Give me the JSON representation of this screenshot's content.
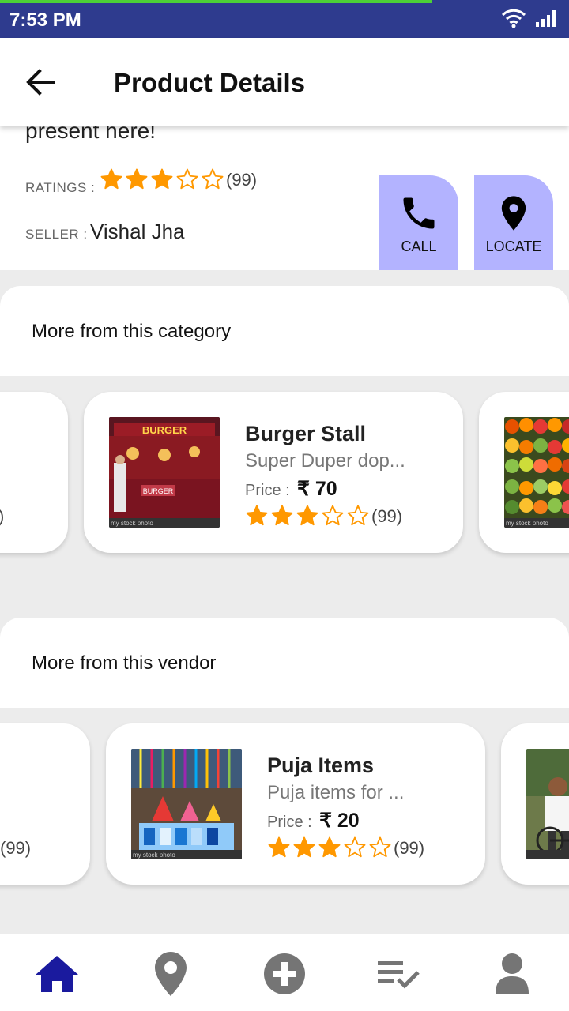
{
  "status": {
    "time": "7:53 PM",
    "progress": 0.76
  },
  "header": {
    "title": "Product Details"
  },
  "product": {
    "description_tail": "present here!",
    "ratings_label": "RATINGS :",
    "rating": 3,
    "rating_max": 5,
    "rating_count": "(99)",
    "seller_label": "SELLER :",
    "seller_name": "Vishal Jha"
  },
  "actions": {
    "call_label": "CALL",
    "locate_label": "LOCATE"
  },
  "category_section": {
    "title": "More from this category",
    "items": [
      {
        "title": "Burger Stall",
        "description": "Super Duper dop...",
        "price_label": "Price :",
        "price": "₹ 70",
        "rating": 3,
        "rating_count": "(99)"
      }
    ],
    "peek_left_count": ")"
  },
  "vendor_section": {
    "title": "More from this vendor",
    "items": [
      {
        "title": "Puja Items",
        "description": "Puja items for ...",
        "price_label": "Price :",
        "price": "₹ 20",
        "rating": 3,
        "rating_count": "(99)"
      }
    ],
    "peek_left_count": "(99)"
  },
  "image_watermark": "my stock photo",
  "burger_sign": "BURGER",
  "colors": {
    "status_bar": "#2e3b8e",
    "accent_blue": "#1a1a9e",
    "star": "#ff9800",
    "action_button": "#b3b3ff",
    "nav_inactive": "#757575"
  },
  "bottom_nav": [
    {
      "name": "home-icon",
      "active": true
    },
    {
      "name": "location-icon",
      "active": false
    },
    {
      "name": "add-icon",
      "active": false
    },
    {
      "name": "list-check-icon",
      "active": false
    },
    {
      "name": "profile-icon",
      "active": false
    }
  ]
}
